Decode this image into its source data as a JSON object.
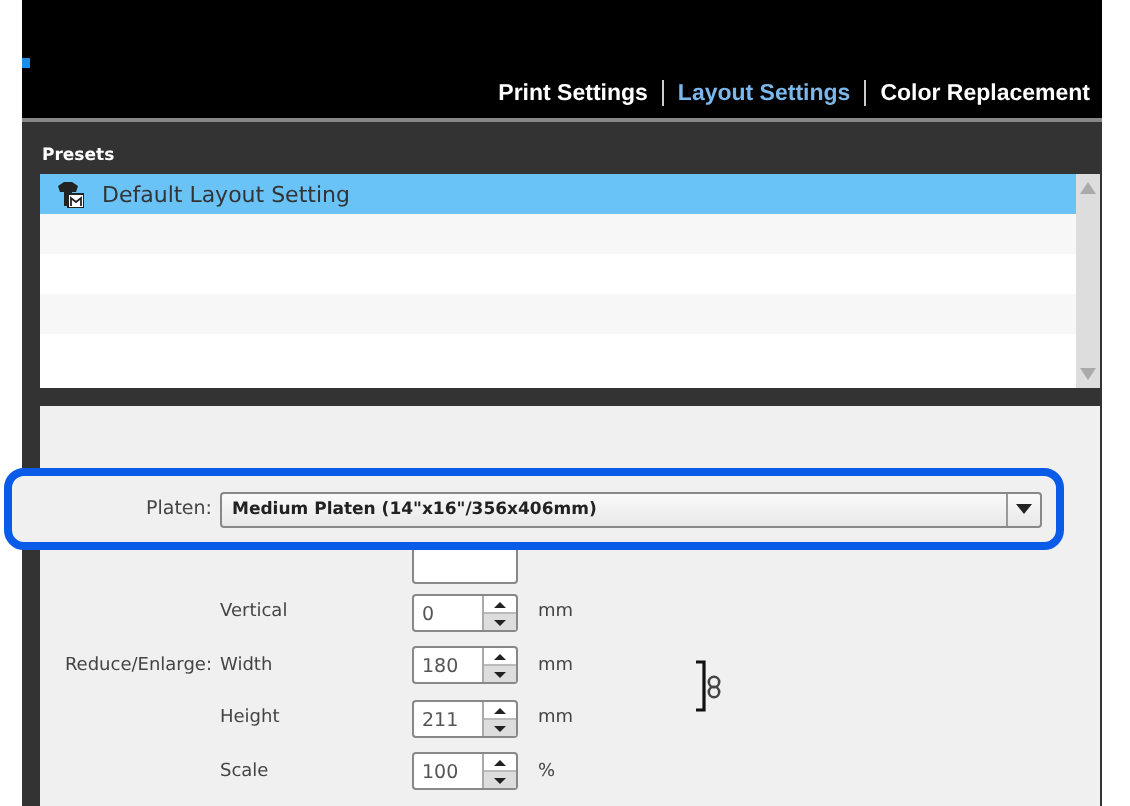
{
  "tabs": [
    {
      "label": "Print Settings",
      "selected": false
    },
    {
      "label": "Layout Settings",
      "selected": true
    },
    {
      "label": "Color Replacement",
      "selected": false
    }
  ],
  "presets": {
    "title": "Presets",
    "items": [
      {
        "label": "Default Layout Setting",
        "selected": true
      }
    ]
  },
  "platen": {
    "label": "Platen:",
    "value": "Medium Platen (14\"x16\"/356x406mm)"
  },
  "fields": [
    {
      "label": "Vertical",
      "value": "0",
      "unit": "mm"
    },
    {
      "group": "Reduce/Enlarge:",
      "label": "Width",
      "value": "180",
      "unit": "mm"
    },
    {
      "label": "Height",
      "value": "211",
      "unit": "mm"
    },
    {
      "label": "Scale",
      "value": "100",
      "unit": "%"
    }
  ]
}
